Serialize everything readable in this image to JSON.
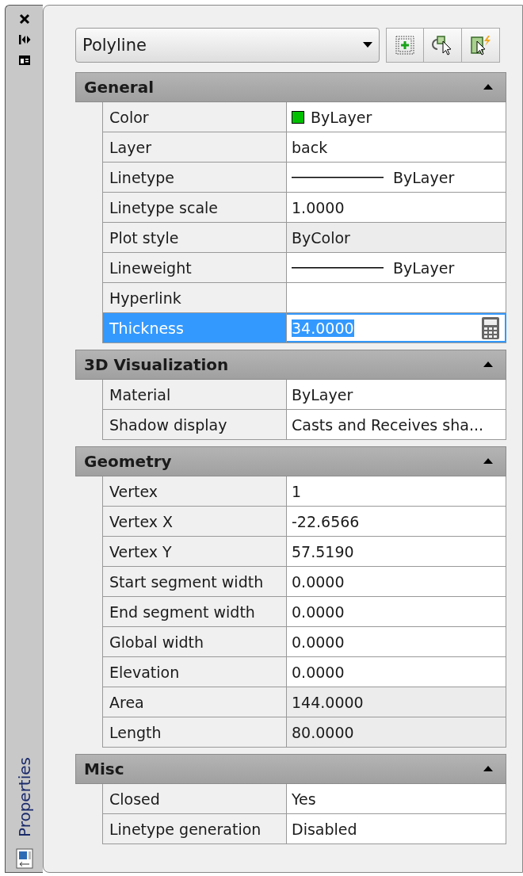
{
  "palette": {
    "title": "Properties"
  },
  "object_type": {
    "value": "Polyline"
  },
  "sections": [
    {
      "title": "General",
      "expanded": true,
      "rows": [
        {
          "label": "Color",
          "value": "ByLayer",
          "kind": "color",
          "color": "#00c000",
          "readonly": false,
          "selected": false
        },
        {
          "label": "Layer",
          "value": "back",
          "kind": "text",
          "readonly": false,
          "selected": false
        },
        {
          "label": "Linetype",
          "value": "ByLayer",
          "kind": "line",
          "readonly": false,
          "selected": false
        },
        {
          "label": "Linetype scale",
          "value": "1.0000",
          "kind": "text",
          "readonly": false,
          "selected": false
        },
        {
          "label": "Plot style",
          "value": "ByColor",
          "kind": "text",
          "readonly": true,
          "selected": false
        },
        {
          "label": "Lineweight",
          "value": "ByLayer",
          "kind": "line",
          "readonly": false,
          "selected": false
        },
        {
          "label": "Hyperlink",
          "kind": "text",
          "readonly": false,
          "selected": false
        },
        {
          "label": "Thickness",
          "value": "34.0000",
          "kind": "text",
          "readonly": false,
          "selected": true
        }
      ]
    },
    {
      "title": "3D Visualization",
      "expanded": true,
      "rows": [
        {
          "label": "Material",
          "value": "ByLayer",
          "kind": "text",
          "readonly": false,
          "selected": false
        },
        {
          "label": "Shadow display",
          "value": "Casts and Receives sha...",
          "kind": "text",
          "readonly": false,
          "selected": false
        }
      ]
    },
    {
      "title": "Geometry",
      "expanded": true,
      "rows": [
        {
          "label": "Vertex",
          "value": "1",
          "kind": "text",
          "readonly": false,
          "selected": false
        },
        {
          "label": "Vertex X",
          "value": "-22.6566",
          "kind": "text",
          "readonly": false,
          "selected": false
        },
        {
          "label": "Vertex Y",
          "value": "57.5190",
          "kind": "text",
          "readonly": false,
          "selected": false
        },
        {
          "label": "Start segment width",
          "value": "0.0000",
          "kind": "text",
          "readonly": false,
          "selected": false
        },
        {
          "label": "End segment width",
          "value": "0.0000",
          "kind": "text",
          "readonly": false,
          "selected": false
        },
        {
          "label": "Global width",
          "value": "0.0000",
          "kind": "text",
          "readonly": false,
          "selected": false
        },
        {
          "label": "Elevation",
          "value": "0.0000",
          "kind": "text",
          "readonly": false,
          "selected": false
        },
        {
          "label": "Area",
          "value": "144.0000",
          "kind": "text",
          "readonly": true,
          "selected": false
        },
        {
          "label": "Length",
          "value": "80.0000",
          "kind": "text",
          "readonly": true,
          "selected": false
        }
      ]
    },
    {
      "title": "Misc",
      "expanded": true,
      "rows": [
        {
          "label": "Closed",
          "value": "Yes",
          "kind": "text",
          "readonly": false,
          "selected": false
        },
        {
          "label": "Linetype generation",
          "value": "Disabled",
          "kind": "text",
          "readonly": false,
          "selected": false
        }
      ]
    }
  ]
}
